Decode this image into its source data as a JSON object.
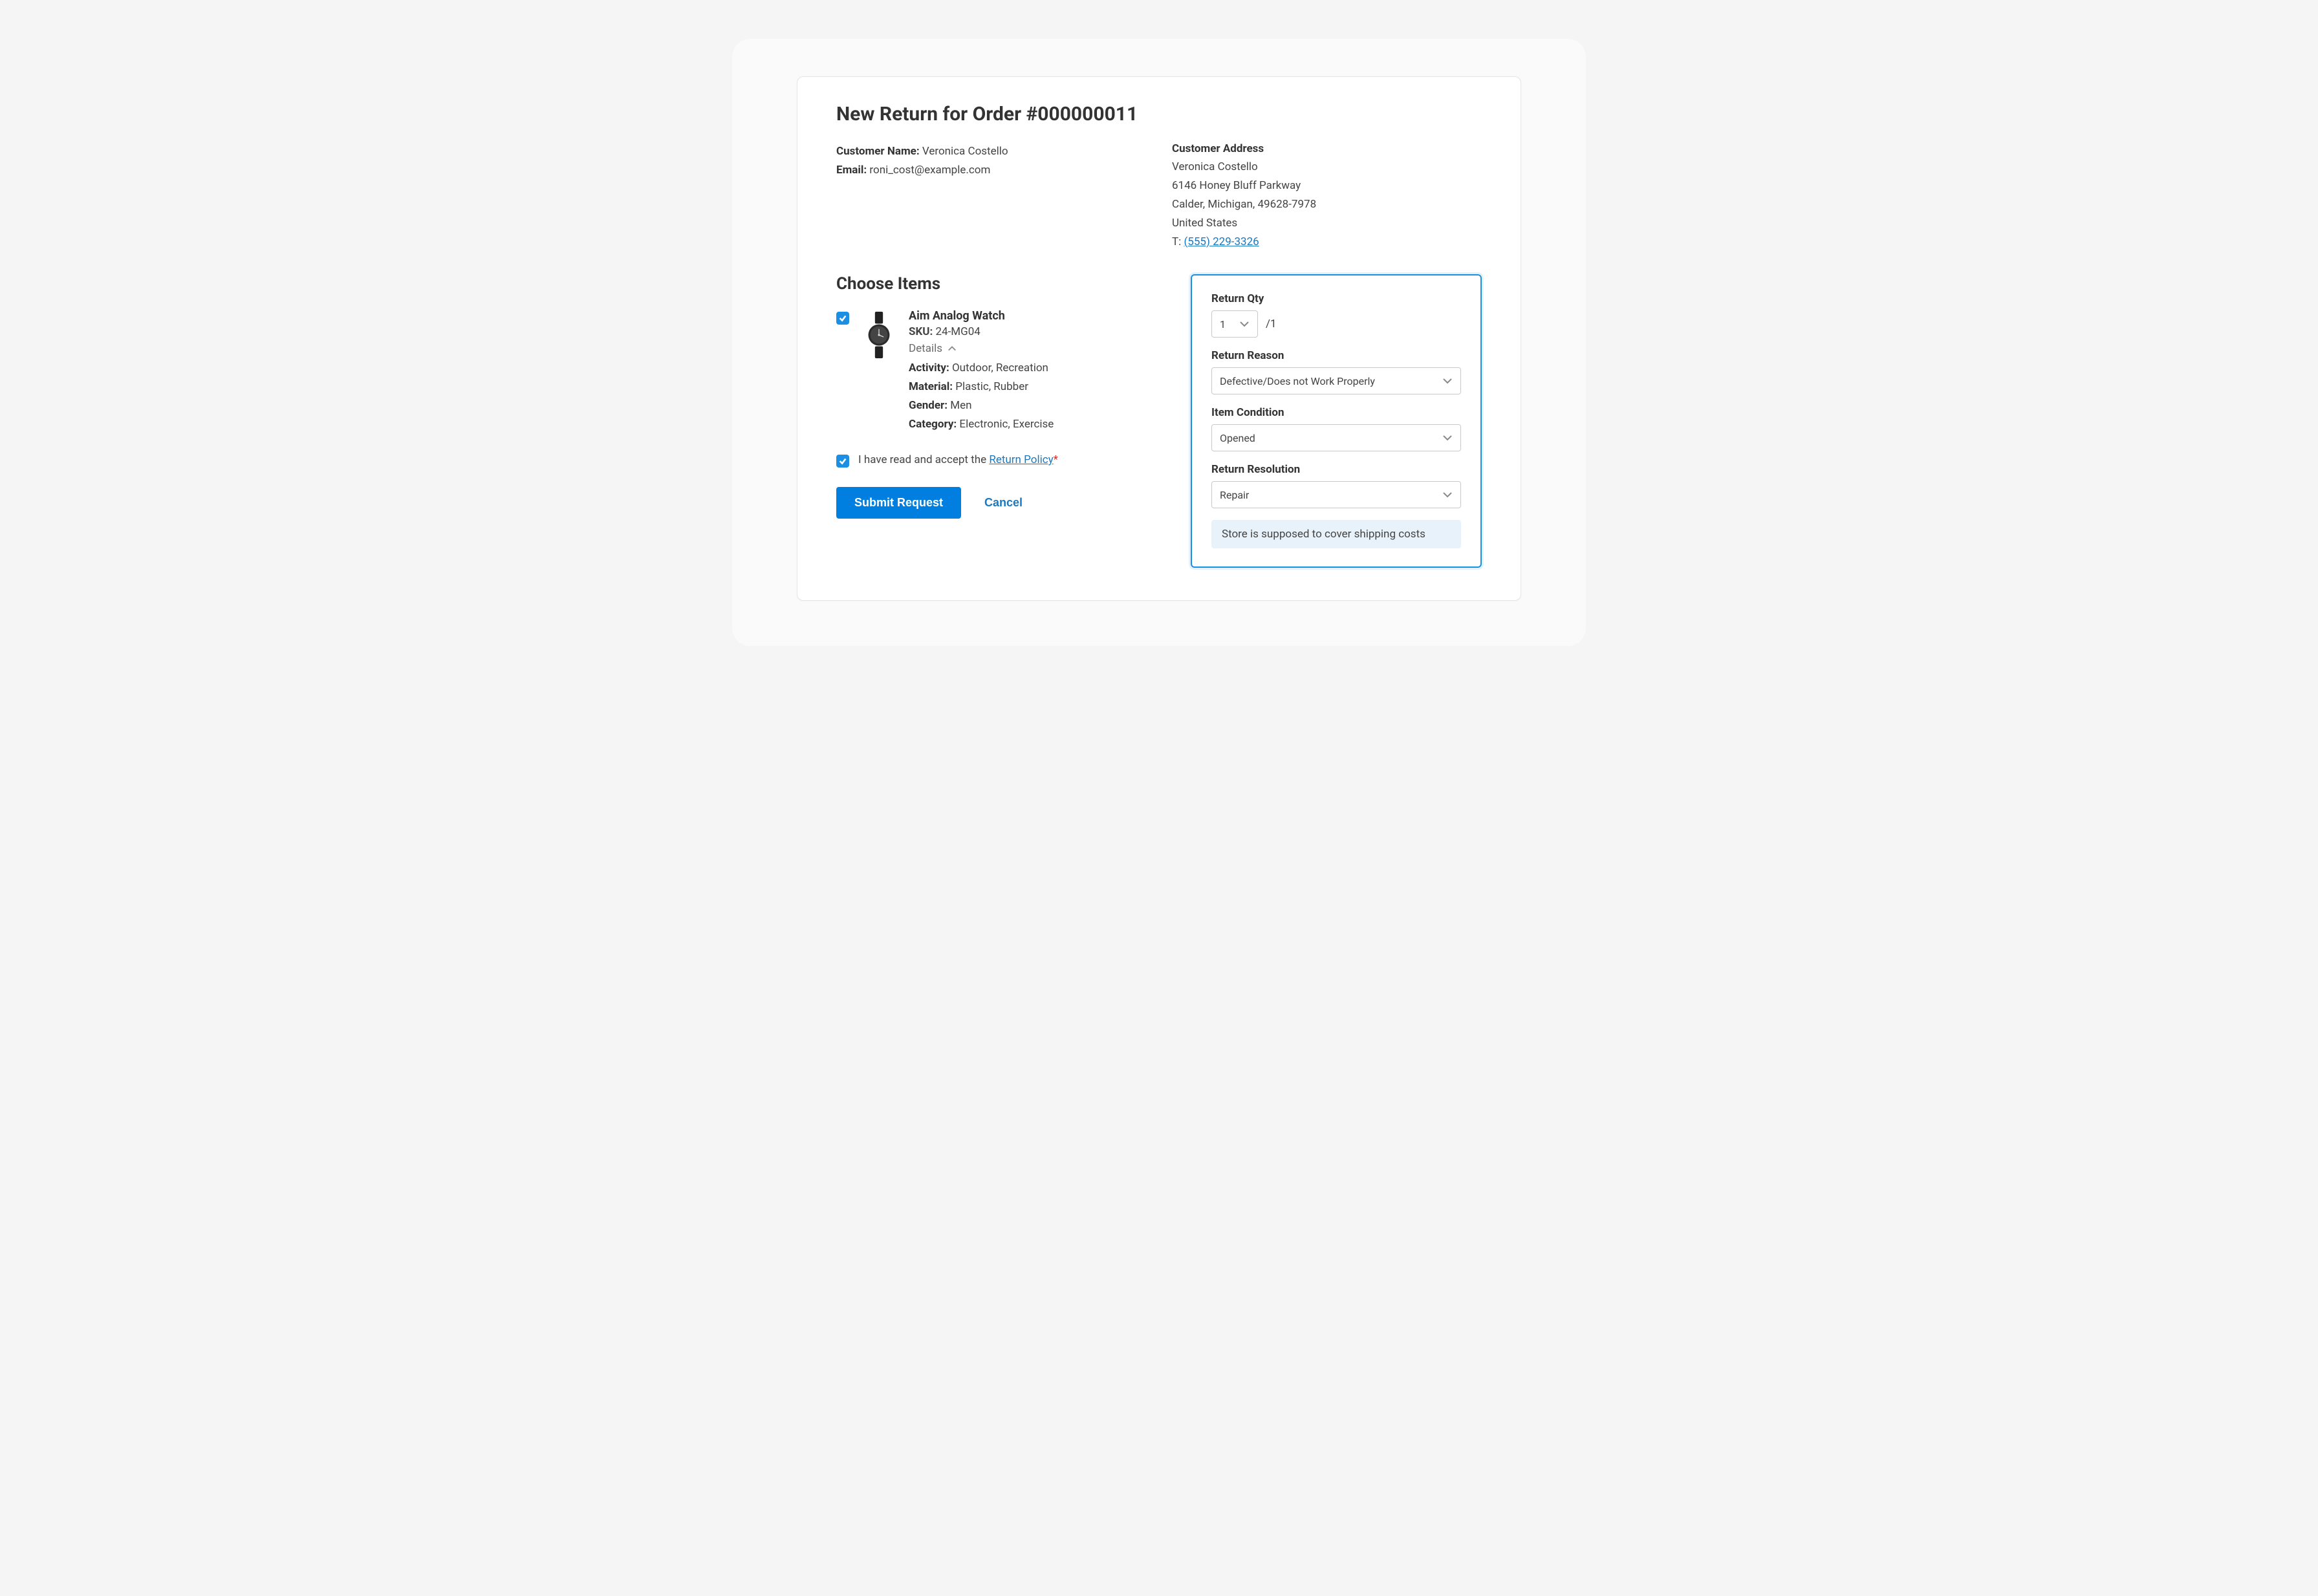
{
  "page_title": "New Return for Order #000000011",
  "customer": {
    "name_label": "Customer Name:",
    "name_value": "Veronica Costello",
    "email_label": "Email:",
    "email_value": "roni_cost@example.com"
  },
  "address": {
    "heading": "Customer Address",
    "name": "Veronica Costello",
    "street": "6146 Honey Bluff Parkway",
    "city_line": "Calder, Michigan, 49628-7978",
    "country": "United States",
    "phone_prefix": "T: ",
    "phone": "(555) 229-3326"
  },
  "choose_items_heading": "Choose Items",
  "item": {
    "name": "Aim Analog Watch",
    "sku_label": "SKU:",
    "sku_value": "24-MG04",
    "details_label": "Details",
    "attrs": {
      "activity_label": "Activity:",
      "activity_value": "Outdoor, Recreation",
      "material_label": "Material:",
      "material_value": "Plastic, Rubber",
      "gender_label": "Gender:",
      "gender_value": "Men",
      "category_label": "Category:",
      "category_value": "Electronic, Exercise"
    }
  },
  "accept": {
    "prefix": "I have read and accept the ",
    "link": "Return Policy",
    "asterisk": "*"
  },
  "buttons": {
    "submit": "Submit Request",
    "cancel": "Cancel"
  },
  "return_form": {
    "qty_label": "Return Qty",
    "qty_value": "1",
    "qty_max": "/1",
    "reason_label": "Return Reason",
    "reason_value": "Defective/Does not Work Properly",
    "condition_label": "Item Condition",
    "condition_value": "Opened",
    "resolution_label": "Return Resolution",
    "resolution_value": "Repair",
    "shipping_note": "Store is supposed to cover shipping costs"
  }
}
